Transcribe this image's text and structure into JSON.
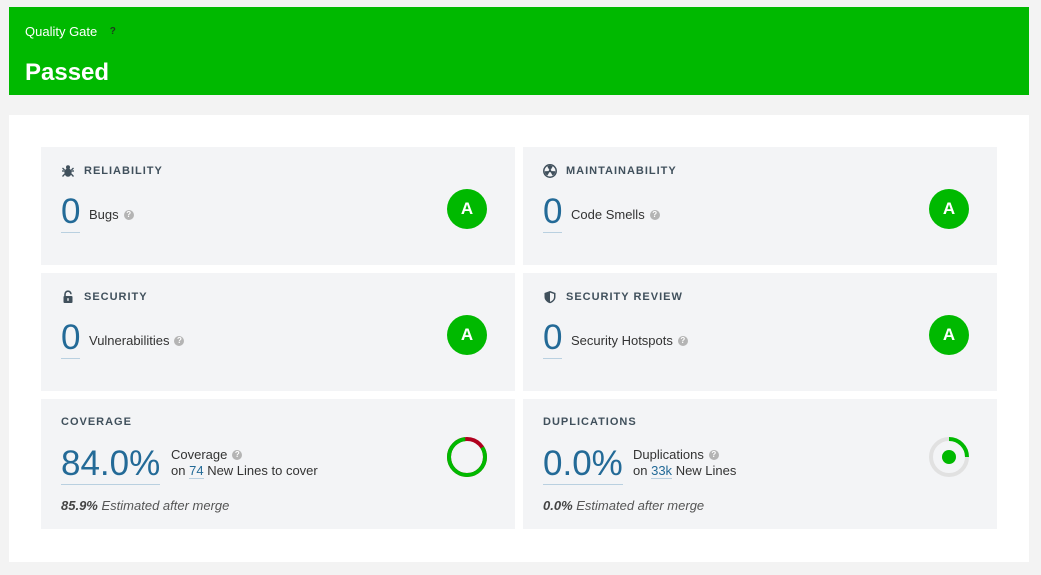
{
  "quality_gate": {
    "label": "Quality Gate",
    "help_icon": "?",
    "status": "Passed",
    "color": "#00b900"
  },
  "reliability": {
    "title": "RELIABILITY",
    "icon": "bug-icon",
    "value": "0",
    "label": "Bugs",
    "rating": "A"
  },
  "maintainability": {
    "title": "MAINTAINABILITY",
    "icon": "radiation-icon",
    "value": "0",
    "label": "Code Smells",
    "rating": "A"
  },
  "security": {
    "title": "SECURITY",
    "icon": "lock-icon",
    "value": "0",
    "label": "Vulnerabilities",
    "rating": "A"
  },
  "security_review": {
    "title": "SECURITY REVIEW",
    "icon": "shield-icon",
    "value": "0",
    "label": "Security Hotspots",
    "rating": "A"
  },
  "coverage": {
    "title": "COVERAGE",
    "value": "84.0%",
    "label": "Coverage",
    "on": "on",
    "lines_count": "74",
    "lines_text": "New Lines to cover",
    "estimate_value": "85.9%",
    "estimate_text": "Estimated after merge",
    "donut_fraction": 0.84
  },
  "duplications": {
    "title": "DUPLICATIONS",
    "value": "0.0%",
    "label": "Duplications",
    "on": "on",
    "lines_count": "33k",
    "lines_text": "New Lines",
    "estimate_value": "0.0%",
    "estimate_text": "Estimated after merge"
  }
}
